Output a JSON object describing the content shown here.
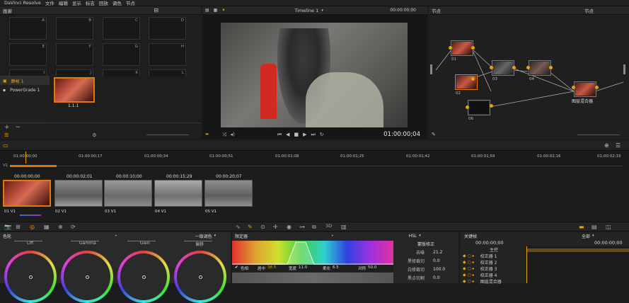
{
  "app": {
    "title": "DaVinci Resolve",
    "menu": [
      "文件",
      "编辑",
      "显示",
      "标志",
      "回放",
      "调色",
      "节点"
    ]
  },
  "gallery": {
    "title": "画廊",
    "slot_letters": [
      "A",
      "B",
      "C",
      "D",
      "E",
      "F",
      "G",
      "H",
      "I",
      "J",
      "K",
      "L"
    ],
    "albums": [
      "静帧 1",
      "PowerGrade 1"
    ],
    "still_label": "1.1.1"
  },
  "viewer": {
    "title": "Timeline 1",
    "timecode_top": "00:00:00;00",
    "timecode": "01:00:00;04"
  },
  "nodes": {
    "title": "节点",
    "list_title": "节点",
    "labels": [
      "01",
      "02",
      "03",
      "04",
      "05",
      "06"
    ],
    "output_label": "图层混合器",
    "menu_title": "节点"
  },
  "timeline": {
    "ruler": [
      "01:00:00;00",
      "01:00:00;17",
      "01:00:00;34",
      "01:00:00;51",
      "01:00:01;08",
      "01:00:01;25",
      "01:00:01;42",
      "01:00:01;59",
      "01:00:02;16",
      "01:00:02;33"
    ],
    "track": "V1",
    "clips": [
      {
        "tc": "00:00:00;00",
        "num": "01",
        "track": "V1"
      },
      {
        "tc": "00:00:02;01",
        "num": "02",
        "track": "V1"
      },
      {
        "tc": "00:00:10;00",
        "num": "03",
        "track": "V1"
      },
      {
        "tc": "00:00:15;29",
        "num": "04",
        "track": "V1"
      },
      {
        "tc": "00:00:20;07",
        "num": "05",
        "track": "V1"
      }
    ]
  },
  "color": {
    "wheels_title": "色轮",
    "mode": "一级调色",
    "wheels": [
      "Lift",
      "Gamma",
      "Gain",
      "偏移"
    ],
    "qualifier_title": "限定器",
    "hsl_mode": "HSL",
    "qualifier_fields": [
      {
        "label": "色相",
        "value": ""
      },
      {
        "label": "居中",
        "value": "38.5"
      },
      {
        "label": "宽度",
        "value": "11.0"
      },
      {
        "label": "柔化",
        "value": "6.5"
      },
      {
        "label": "对称",
        "value": "50.0"
      }
    ],
    "matte_title": "蒙版修正",
    "matte_fields": [
      {
        "label": "去噪",
        "value": "21.2"
      },
      {
        "label": "黑修裁切",
        "value": "0.0"
      },
      {
        "label": "白修裁切",
        "value": "100.0"
      },
      {
        "label": "黑点切割",
        "value": "0.0"
      }
    ],
    "keyframe_title": "关键帧",
    "keyframe_mode": "全部",
    "kf_tc_left": "00:00:00;00",
    "kf_tc_right": "00:00:00;00",
    "kf_tracks": [
      "主控",
      "校正器 1",
      "校正器 2",
      "校正器 3",
      "校正器 4",
      "图层混合器"
    ]
  },
  "colors": {
    "accent": "#e8a400",
    "orange_track": "#d9730d",
    "select": "#e07a10"
  }
}
